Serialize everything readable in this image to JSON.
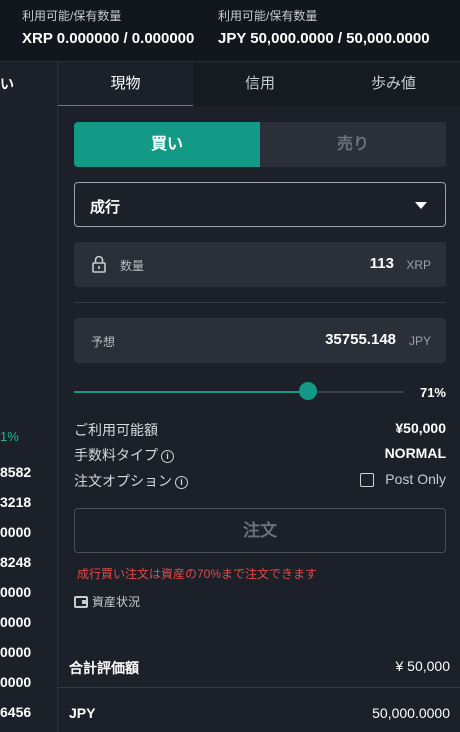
{
  "balances": [
    {
      "label": "利用可能/保有数量",
      "value": "XRP 0.000000 / 0.000000"
    },
    {
      "label": "利用可能/保有数量",
      "value": "JPY 50,000.0000 / 50,000.0000"
    }
  ],
  "left_panel": {
    "head": "い",
    "percent": "1%",
    "rows": [
      "8582",
      "3218",
      "0000",
      "8248",
      "0000",
      "0000",
      "0000",
      "0000",
      "6456"
    ]
  },
  "tabs": [
    "現物",
    "信用",
    "歩み値"
  ],
  "side": {
    "buy": "買い",
    "sell": "売り"
  },
  "order_type": {
    "selected": "成行",
    "icon": "chevron-down-icon"
  },
  "quantity": {
    "label": "数量",
    "value": "113",
    "unit": "XRP",
    "icon": "lock-icon"
  },
  "estimate": {
    "label": "予想",
    "value": "35755.148",
    "unit": "JPY"
  },
  "slider": {
    "percent_label": "71%",
    "fraction": 0.71
  },
  "info": {
    "available_label": "ご利用可能額",
    "available_value": "¥50,000",
    "fee_label": "手数料タイプ",
    "fee_value": "NORMAL",
    "option_label": "注文オプション",
    "post_only": "Post Only",
    "info_icon": "i"
  },
  "order_button": "注文",
  "warning": "成行買い注文は資産の70%まで注文できます",
  "asset_link": "資産状況",
  "summary": {
    "total_label": "合計評価額",
    "total_value": "¥ 50,000",
    "jpy_label": "JPY",
    "jpy_value": "50,000.0000"
  },
  "colors": {
    "accent": "#129a87",
    "warning": "#e04a4a",
    "tab_underline": "#2c8ed6"
  }
}
